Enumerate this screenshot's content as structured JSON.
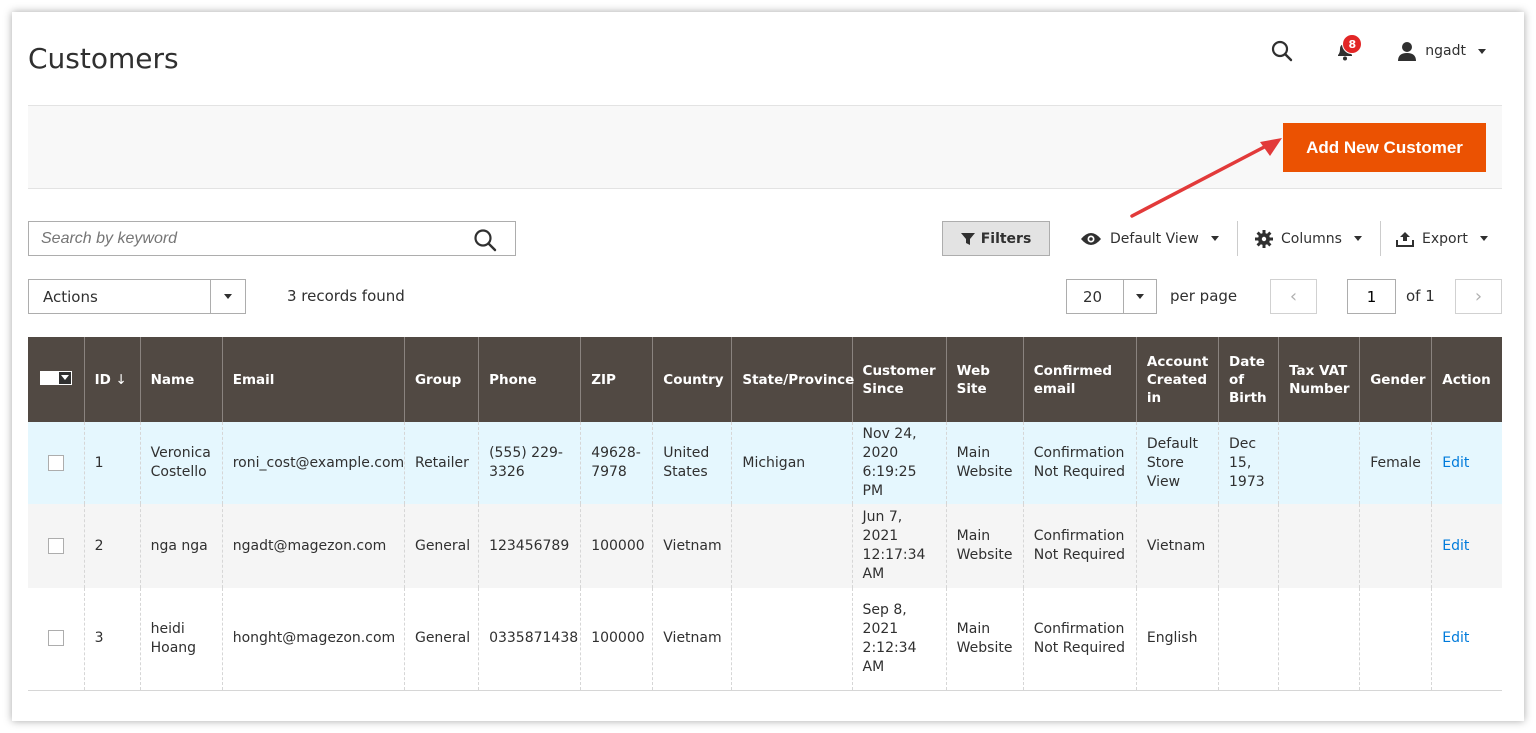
{
  "header": {
    "title": "Customers",
    "notifications_count": "8",
    "username": "ngadt"
  },
  "action_bar": {
    "add_button": "Add New Customer"
  },
  "toolbar": {
    "search_placeholder": "Search by keyword",
    "filters_label": "Filters",
    "view_label": "Default View",
    "columns_label": "Columns",
    "export_label": "Export",
    "actions_label": "Actions",
    "records_found": "3 records found",
    "per_page_value": "20",
    "per_page_label": "per page",
    "current_page": "1",
    "total_pages": "of 1"
  },
  "table": {
    "columns": [
      "ID",
      "Name",
      "Email",
      "Group",
      "Phone",
      "ZIP",
      "Country",
      "State/Province",
      "Customer Since",
      "Web Site",
      "Confirmed email",
      "Account Created in",
      "Date of Birth",
      "Tax VAT Number",
      "Gender",
      "Action"
    ],
    "rows": [
      {
        "id": "1",
        "name": "Veronica Costello",
        "email": "roni_cost@example.com",
        "group": "Retailer",
        "phone": "(555) 229-3326",
        "zip": "49628-7978",
        "country": "United States",
        "state": "Michigan",
        "since": "Nov 24, 2020 6:19:25 PM",
        "website": "Main Website",
        "confirmed": "Confirmation Not Required",
        "created_in": "Default Store View",
        "dob": "Dec 15, 1973",
        "taxvat": "",
        "gender": "Female",
        "action": "Edit"
      },
      {
        "id": "2",
        "name": "nga nga",
        "email": "ngadt@magezon.com",
        "group": "General",
        "phone": "123456789",
        "zip": "100000",
        "country": "Vietnam",
        "state": "",
        "since": "Jun 7, 2021 12:17:34 AM",
        "website": "Main Website",
        "confirmed": "Confirmation Not Required",
        "created_in": "Vietnam",
        "dob": "",
        "taxvat": "",
        "gender": "",
        "action": "Edit"
      },
      {
        "id": "3",
        "name": "heidi Hoang",
        "email": "honght@magezon.com",
        "group": "General",
        "phone": "0335871438",
        "zip": "100000",
        "country": "Vietnam",
        "state": "",
        "since": "Sep 8, 2021 2:12:34 AM",
        "website": "Main Website",
        "confirmed": "Confirmation Not Required",
        "created_in": "English",
        "dob": "",
        "taxvat": "",
        "gender": "",
        "action": "Edit"
      }
    ]
  },
  "colors": {
    "accent": "#eb5202",
    "table_header": "#514943",
    "link": "#007bdb",
    "badge": "#e22626"
  }
}
